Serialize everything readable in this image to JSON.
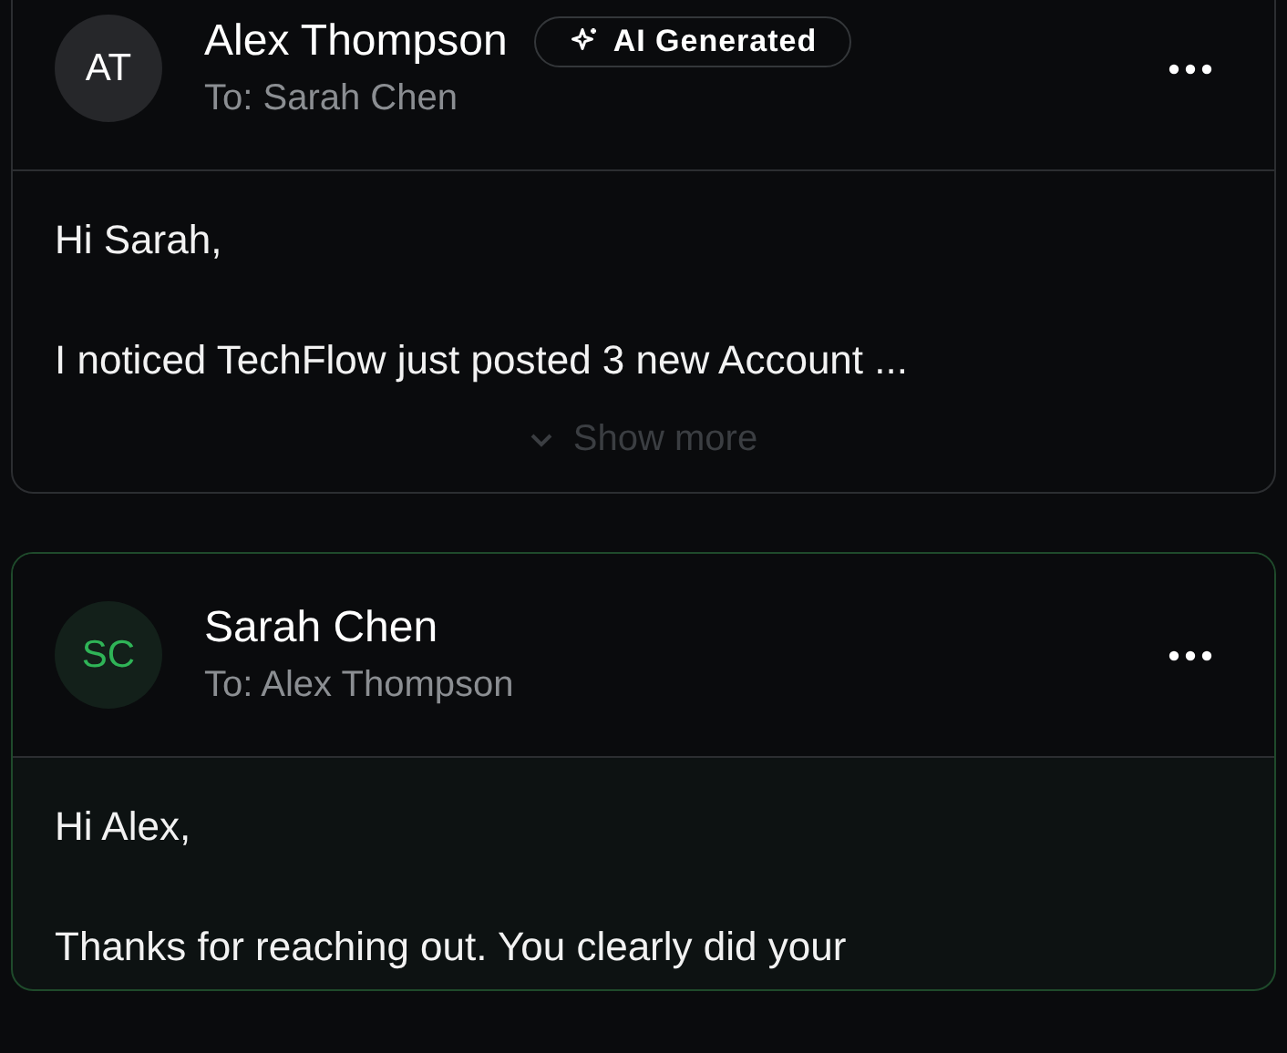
{
  "messages": [
    {
      "initials": "AT",
      "sender": "Alex Thompson",
      "badge": "AI Generated",
      "recipient": "To: Sarah Chen",
      "highlighted": false,
      "paragraphs": [
        "Hi Sarah,",
        "I noticed TechFlow just posted 3 new Account ..."
      ],
      "show_more": "Show more"
    },
    {
      "initials": "SC",
      "sender": "Sarah Chen",
      "recipient": "To: Alex Thompson",
      "highlighted": true,
      "paragraphs": [
        "Hi Alex,",
        "Thanks for reaching out. You clearly did your"
      ]
    }
  ]
}
